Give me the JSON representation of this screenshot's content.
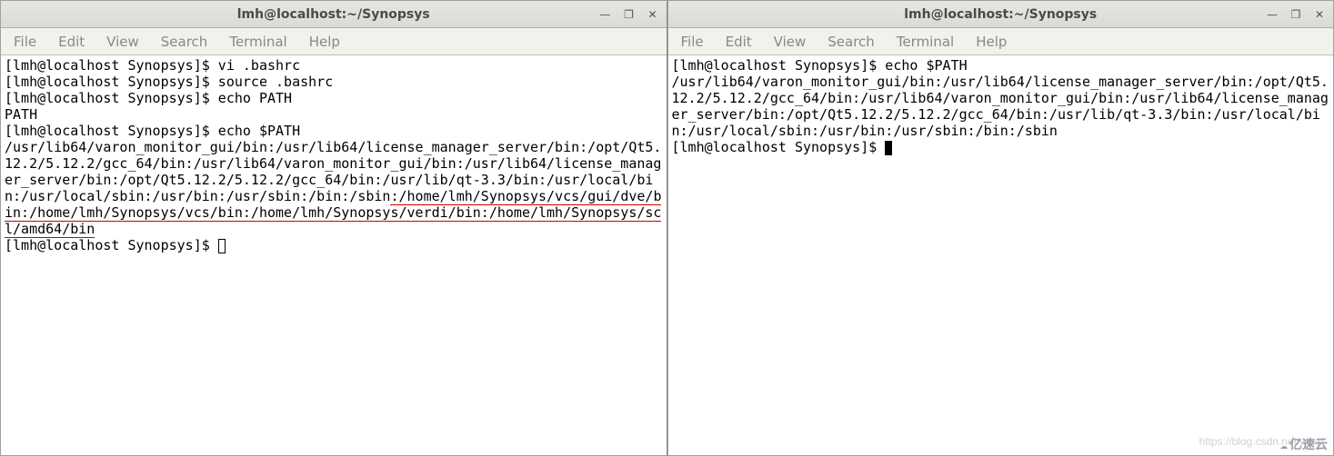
{
  "leftWindow": {
    "title": "lmh@localhost:~/Synopsys",
    "menu": [
      "File",
      "Edit",
      "View",
      "Search",
      "Terminal",
      "Help"
    ],
    "content": {
      "line1": "[lmh@localhost Synopsys]$ vi .bashrc",
      "line2": "[lmh@localhost Synopsys]$ source .bashrc",
      "line3": "[lmh@localhost Synopsys]$ echo PATH",
      "line4": "PATH",
      "line5": "[lmh@localhost Synopsys]$ echo $PATH",
      "path_pre": "/usr/lib64/varon_monitor_gui/bin:/usr/lib64/license_manager_server/bin:/opt/Qt5.12.2/5.12.2/gcc_64/bin:/usr/lib64/varon_monitor_gui/bin:/usr/lib64/license_manager_server/bin:/opt/Qt5.12.2/5.12.2/gcc_64/bin:/usr/lib/qt-3.3/bin:/usr/local/bin:/usr/local/sbin:/usr/bin:/usr/sbin:/bin:/sbin",
      "path_underlined": ":/home/lmh/Synopsys/vcs/gui/dve/bin:/home/lmh/Synopsys/vcs/bin:/home/lmh/Synopsys/verdi/bin:/home/lmh/Synopsys/scl/amd64/bin",
      "prompt_final": "[lmh@localhost Synopsys]$ "
    }
  },
  "rightWindow": {
    "title": "lmh@localhost:~/Synopsys",
    "menu": [
      "File",
      "Edit",
      "View",
      "Search",
      "Terminal",
      "Help"
    ],
    "content": {
      "line1": "[lmh@localhost Synopsys]$ echo $PATH",
      "path": "/usr/lib64/varon_monitor_gui/bin:/usr/lib64/license_manager_server/bin:/opt/Qt5.12.2/5.12.2/gcc_64/bin:/usr/lib64/varon_monitor_gui/bin:/usr/lib64/license_manager_server/bin:/opt/Qt5.12.2/5.12.2/gcc_64/bin:/usr/lib/qt-3.3/bin:/usr/local/bin:/usr/local/sbin:/usr/bin:/usr/sbin:/bin:/sbin",
      "prompt_final": "[lmh@localhost Synopsys]$ "
    }
  },
  "watermark": "https://blog.csdn.net/weixi",
  "logo": "亿速云"
}
